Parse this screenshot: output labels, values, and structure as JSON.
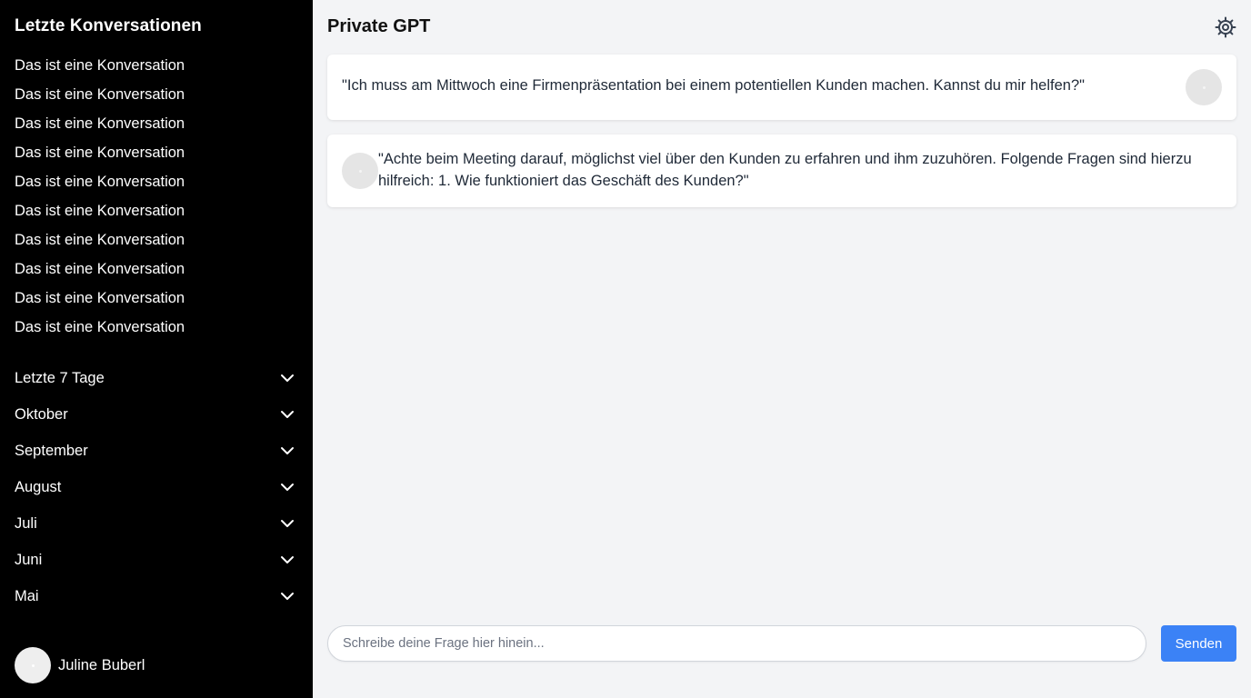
{
  "sidebar": {
    "title": "Letzte Konversationen",
    "conversations": [
      "Das ist eine Konversation",
      "Das ist eine Konversation",
      "Das ist eine Konversation",
      "Das ist eine Konversation",
      "Das ist eine Konversation",
      "Das ist eine Konversation",
      "Das ist eine Konversation",
      "Das ist eine Konversation",
      "Das ist eine Konversation",
      "Das ist eine Konversation"
    ],
    "months": [
      "Letzte 7 Tage",
      "Oktober",
      "September",
      "August",
      "Juli",
      "Juni",
      "Mai"
    ],
    "month_icon": "chevron-down-icon",
    "user": {
      "name": "Juline Buberl",
      "avatar_icon": "avatar"
    }
  },
  "header": {
    "title": "Private GPT",
    "settings_icon": "gear-icon"
  },
  "messages": [
    {
      "role": "user",
      "text": "\"Ich muss am Mittwoch eine Firmenpräsentation bei einem potentiellen Kunden machen. Kannst du mir helfen?\""
    },
    {
      "role": "assistant",
      "text": "\"Achte beim Meeting darauf, möglichst viel über den Kunden zu erfahren und ihm zuzuhören. Folgende Fragen sind hierzu hilfreich: 1. Wie funktioniert das Geschäft des Kunden?\""
    }
  ],
  "composer": {
    "placeholder": "Schreibe deine Frage hier hinein...",
    "value": "",
    "send_label": "Senden"
  },
  "colors": {
    "sidebar_bg": "#000000",
    "main_bg": "#f3f4f6",
    "accent": "#3b82f6"
  }
}
